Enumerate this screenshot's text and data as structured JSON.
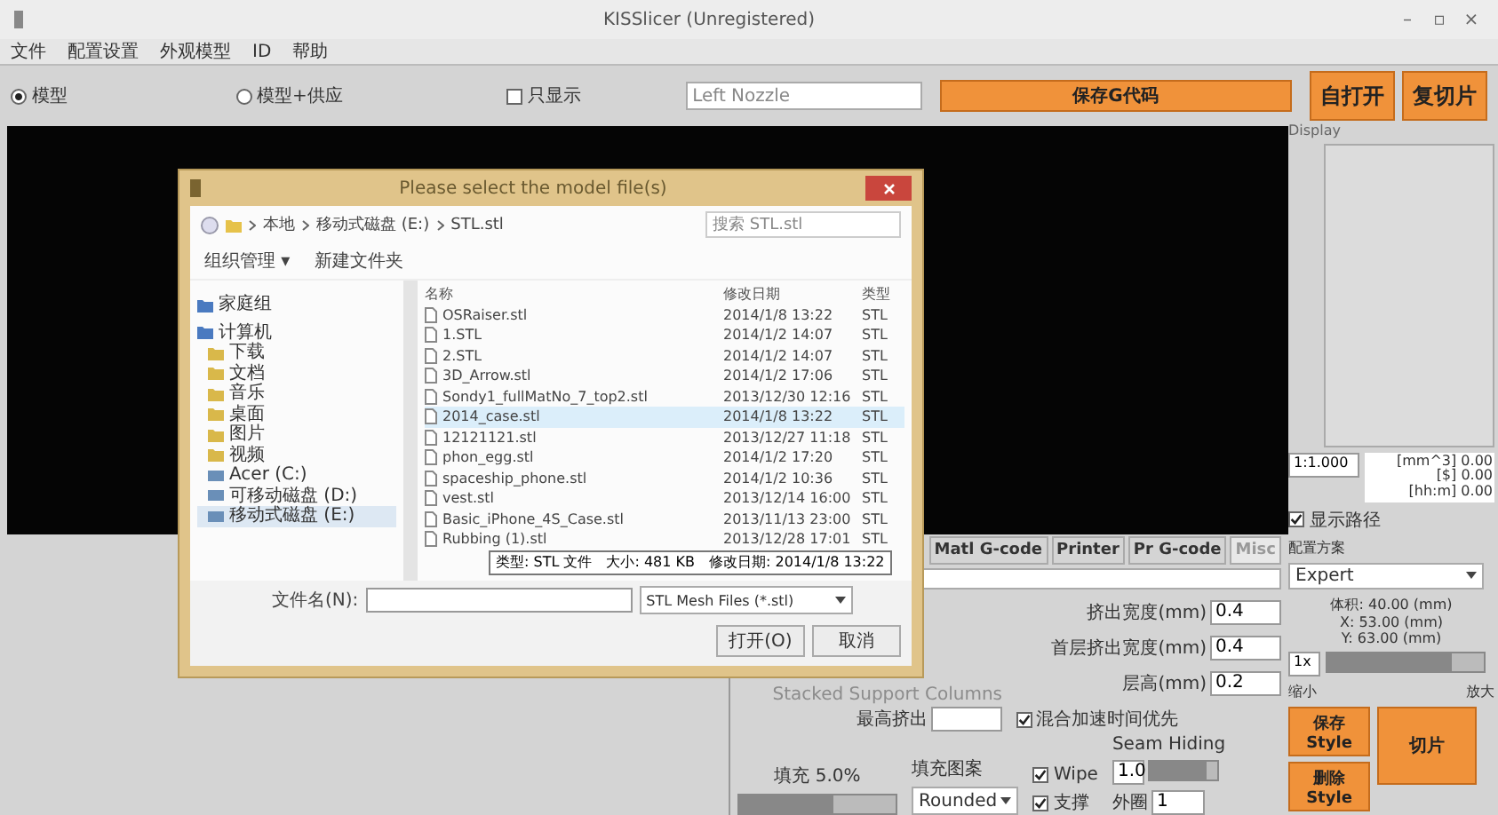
{
  "window": {
    "title": "KISSlicer (Unregistered)",
    "controls": [
      "–",
      "▫",
      "×"
    ]
  },
  "menu": [
    "文件",
    "配置设置",
    "外观模型",
    "ID",
    "帮助"
  ],
  "toolbar": {
    "modes": [
      {
        "label": "模型",
        "selected": true
      },
      {
        "label": "模型+供应",
        "selected": false
      }
    ],
    "only_show": {
      "label": "只显示",
      "checked": false
    },
    "nozzle": {
      "placeholder": "Left Nozzle"
    },
    "save_button": "保存G代码",
    "right_buttons": [
      "自打开",
      "复切片"
    ]
  },
  "preview": {
    "label": "Display",
    "scale": "1:1.000",
    "readout": [
      "[mm^3] 0.00",
      "[$] 0.00",
      "[hh:m] 0.00"
    ]
  },
  "dialog": {
    "title": "Please select the model file(s)",
    "path": [
      "本地",
      "移动式磁盘 (E:)",
      "STL.stl"
    ],
    "search": {
      "placeholder": "搜索 STL.stl"
    },
    "actions": [
      "组织管理 ▾",
      "新建文件夹"
    ],
    "nav": [
      {
        "label": "家庭组",
        "kind": "group",
        "selected": false
      },
      {
        "label": "计算机",
        "kind": "group",
        "selected": false
      },
      {
        "label": "下载",
        "kind": "item",
        "selected": false
      },
      {
        "label": "文档",
        "kind": "item",
        "selected": false
      },
      {
        "label": "音乐",
        "kind": "item",
        "selected": false
      },
      {
        "label": "桌面",
        "kind": "item",
        "selected": false
      },
      {
        "label": "图片",
        "kind": "item",
        "selected": false
      },
      {
        "label": "视频",
        "kind": "item",
        "selected": false
      },
      {
        "label": "Acer (C:)",
        "kind": "drive",
        "selected": false
      },
      {
        "label": "可移动磁盘 (D:)",
        "kind": "drive",
        "selected": false
      },
      {
        "label": "移动式磁盘 (E:)",
        "kind": "drive",
        "selected": true
      }
    ],
    "columns": [
      "名称",
      "修改日期",
      "类型"
    ],
    "files": [
      {
        "name": "OSRaiser.stl",
        "date": "2014/1/8 13:22",
        "type": "STL",
        "selected": false
      },
      {
        "name": "1.STL",
        "date": "2014/1/2 14:07",
        "type": "STL",
        "selected": false
      },
      {
        "name": "2.STL",
        "date": "2014/1/2 14:07",
        "type": "STL",
        "selected": false
      },
      {
        "name": "3D_Arrow.stl",
        "date": "2014/1/2 17:06",
        "type": "STL",
        "selected": false
      },
      {
        "name": "Sondy1_fullMatNo_7_top2.stl",
        "date": "2013/12/30 12:16",
        "type": "STL",
        "selected": false
      },
      {
        "name": "2014_case.stl",
        "date": "2014/1/8 13:22",
        "type": "STL",
        "selected": true
      },
      {
        "name": "12121121.stl",
        "date": "2013/12/27 11:18",
        "type": "STL",
        "selected": false
      },
      {
        "name": "phon_egg.stl",
        "date": "2014/1/2 17:20",
        "type": "STL",
        "selected": false
      },
      {
        "name": "spaceship_phone.stl",
        "date": "2014/1/2 10:36",
        "type": "STL",
        "selected": false
      },
      {
        "name": "vest.stl",
        "date": "2013/12/14 16:00",
        "type": "STL",
        "selected": false
      },
      {
        "name": "Basic_iPhone_4S_Case.stl",
        "date": "2013/11/13 23:00",
        "type": "STL",
        "selected": false
      },
      {
        "name": "Rubbing (1).stl",
        "date": "2013/12/28 17:01",
        "type": "STL",
        "selected": false
      }
    ],
    "tooltip": [
      "类型: STL 文件",
      "大小: 481 KB",
      "修改日期: 2014/1/8 13:22"
    ],
    "filename_label": "文件名(N):",
    "filetype": "STL Mesh Files (*.stl)",
    "buttons": [
      "打开(O)",
      "取消"
    ]
  },
  "settings": {
    "tabs": [
      {
        "label": "Matl G-code",
        "selected": false
      },
      {
        "label": "Printer",
        "selected": false
      },
      {
        "label": "Pr G-code",
        "selected": false
      },
      {
        "label": "Misc",
        "selected": true
      }
    ],
    "fields_right": [
      {
        "label": "挤出宽度(mm)",
        "value": "0.4"
      },
      {
        "label": "首层挤出宽度(mm)",
        "value": "0.4"
      },
      {
        "label": "层高(mm)",
        "value": "0.2"
      }
    ],
    "stacked": {
      "label": "Stacked Support Columns",
      "disabled": true
    },
    "top_field": {
      "label": "最高挤出"
    },
    "mix_check": {
      "label": "混合加速时间优先",
      "checked": true
    },
    "infill": {
      "label": "填充 5.0%",
      "level": 0.6
    },
    "pattern": {
      "label": "填充图案",
      "value": "Rounded"
    },
    "checks": [
      {
        "label": "Wipe",
        "checked": true
      },
      {
        "label": "支撑",
        "checked": true
      }
    ],
    "seam": {
      "label": "Seam Hiding",
      "value": "1.0",
      "level": 0.85
    },
    "outer": {
      "label": "外圈",
      "value": "1"
    }
  },
  "side": {
    "show_path": {
      "label": "显示路径",
      "checked": true
    },
    "profile_label": "配置方案",
    "profile": "Expert",
    "info": [
      "体积: 40.00 (mm)",
      "X: 53.00 (mm)",
      "Y: 63.00 (mm)"
    ],
    "zoom": {
      "value": "1x",
      "level": 0.8
    },
    "labels": [
      "缩小",
      "放大"
    ],
    "buttons": [
      "保存 Style",
      "删除 Style"
    ],
    "slice": "切片"
  }
}
